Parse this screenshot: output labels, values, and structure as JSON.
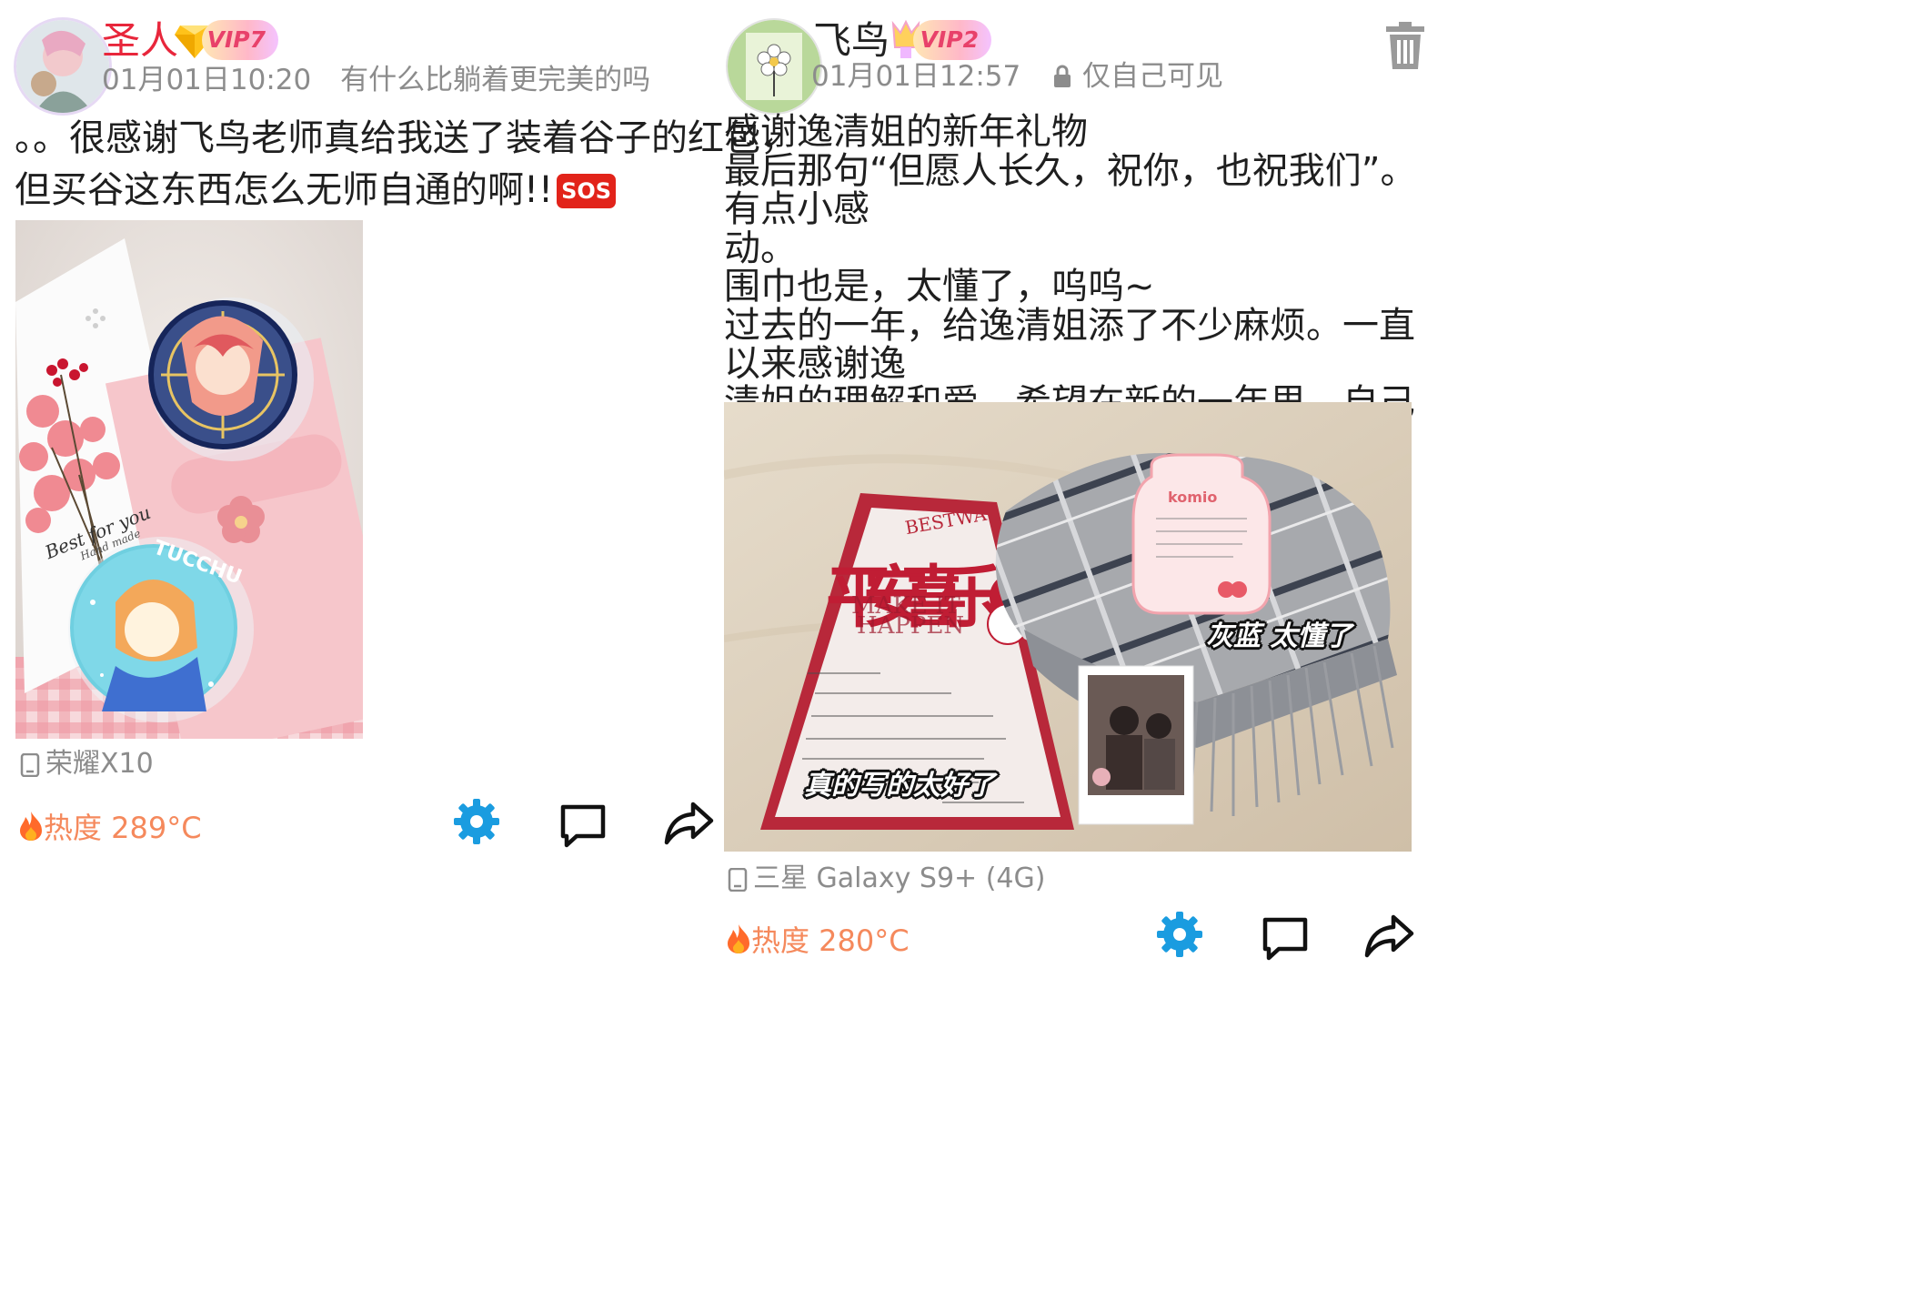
{
  "posts": [
    {
      "username": "圣人",
      "vip_label": "VIP7",
      "time": "01月01日10:20",
      "signature": "有什么比躺着更完美的吗",
      "text": "。。很感谢飞鸟老师真给我送了装着谷子的红包，\n但买谷这东西怎么无师自通的啊!!",
      "text_emoji": "SOS",
      "photo_captions": {
        "card_script": "Best for you",
        "card_sub": "Hand made",
        "badge_text": "TUCCHU"
      },
      "device": "荣耀X10",
      "heat": "热度 289°C"
    },
    {
      "username": "飞鸟",
      "vip_label": "VIP2",
      "time": "01月01日12:57",
      "privacy": "仅自己可见",
      "text": "感谢逸清姐的新年礼物\n最后那句“但愿人长久，祝你，也祝我们”。有点小感\n动。\n围巾也是，太懂了，呜呜~\n过去的一年，给逸清姐添了不少麻烦。一直以来感谢逸\n清姐的理解和爱。希望在新的一年里，自己能够有所成\n长，更温柔地，更好地爱你！",
      "photo_captions": {
        "card_brand": "BESTWA",
        "card_big": "平安喜乐",
        "card_en1": "MAKE IT",
        "card_en2": "HAPPEN",
        "bottle_brand": "komio",
        "sticker_scarf": "灰蓝 太懂了",
        "sticker_letter": "真的写的太好了"
      },
      "device": "三星 Galaxy S9+ (4G)",
      "heat": "热度 280°C"
    }
  ],
  "colors": {
    "username_vip": "#e8263b",
    "meta_gray": "#8c8c8c",
    "heat_orange": "#f5895c",
    "settings_blue": "#1a9ce0"
  },
  "icons": [
    "flame-icon",
    "settings-icon",
    "comment-icon",
    "share-icon",
    "phone-icon",
    "lock-icon",
    "trash-icon"
  ]
}
